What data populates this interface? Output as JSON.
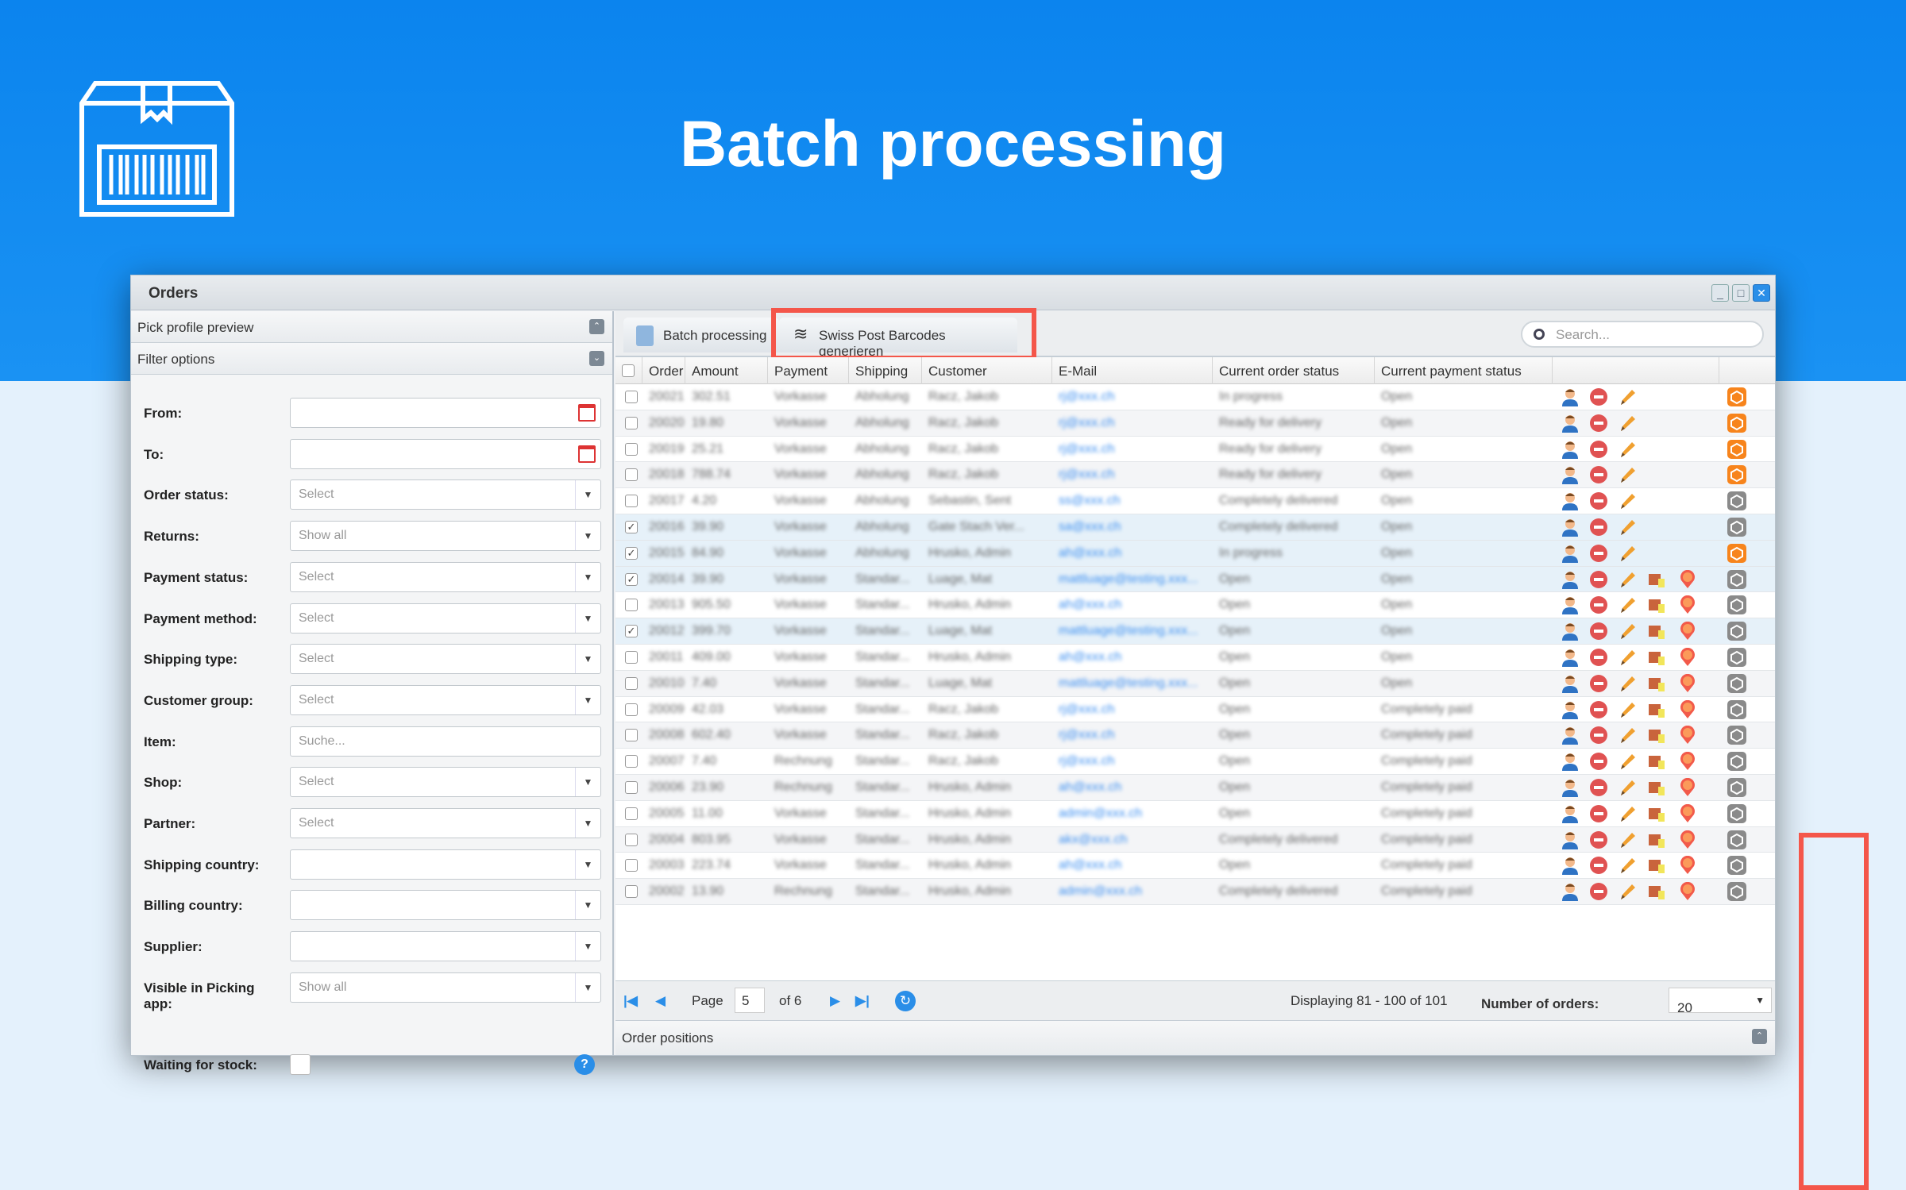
{
  "banner": {
    "title": "Batch processing",
    "logo": "barcode-box-icon",
    "bg": "#0b84ee"
  },
  "window": {
    "title": "Orders",
    "controls": [
      "minimize",
      "maximize",
      "close"
    ]
  },
  "left": {
    "pick_profile": "Pick profile preview",
    "filter_options": "Filter options",
    "filters": [
      {
        "label": "From:",
        "value": "",
        "type": "date"
      },
      {
        "label": "To:",
        "value": "",
        "type": "date"
      },
      {
        "label": "Order status:",
        "value": "Select",
        "type": "select"
      },
      {
        "label": "Returns:",
        "value": "Show all",
        "type": "select"
      },
      {
        "label": "Payment status:",
        "value": "Select",
        "type": "select"
      },
      {
        "label": "Payment method:",
        "value": "Select",
        "type": "select"
      },
      {
        "label": "Shipping type:",
        "value": "Select",
        "type": "select"
      },
      {
        "label": "Customer group:",
        "value": "Select",
        "type": "select"
      },
      {
        "label": "Item:",
        "value": "Suche...",
        "type": "text"
      },
      {
        "label": "Shop:",
        "value": "Select",
        "type": "select"
      },
      {
        "label": "Partner:",
        "value": "Select",
        "type": "select"
      },
      {
        "label": "Shipping country:",
        "value": "",
        "type": "select"
      },
      {
        "label": "Billing country:",
        "value": "",
        "type": "select"
      },
      {
        "label": "Supplier:",
        "value": "",
        "type": "select"
      },
      {
        "label": "Visible in Picking app:",
        "value": "Show all",
        "type": "select"
      }
    ],
    "waiting": "Waiting for stock:"
  },
  "toolbar": {
    "batch": "Batch processing",
    "swiss": "Swiss Post Barcodes generieren",
    "search_placeholder": "Search..."
  },
  "columns": [
    "Order numb",
    "Amount",
    "Payment",
    "Shipping",
    "Customer",
    "E-Mail",
    "Current order status",
    "Current payment status"
  ],
  "rows": [
    [
      "20021",
      "302.51",
      "Vorkasse",
      "Abholung",
      "Racz, Jakob",
      "rj@xxx.ch",
      "In progress",
      "Open",
      false,
      "orange",
      false
    ],
    [
      "20020",
      "19.80",
      "Vorkasse",
      "Abholung",
      "Racz, Jakob",
      "rj@xxx.ch",
      "Ready for delivery",
      "Open",
      false,
      "orange",
      false
    ],
    [
      "20019",
      "25.21",
      "Vorkasse",
      "Abholung",
      "Racz, Jakob",
      "rj@xxx.ch",
      "Ready for delivery",
      "Open",
      false,
      "orange",
      false
    ],
    [
      "20018",
      "788.74",
      "Vorkasse",
      "Abholung",
      "Racz, Jakob",
      "rj@xxx.ch",
      "Ready for delivery",
      "Open",
      false,
      "orange",
      false
    ],
    [
      "20017",
      "4.20",
      "Vorkasse",
      "Abholung",
      "Sebastin, Sent",
      "ss@xxx.ch",
      "Completely delivered",
      "Open",
      false,
      "gray",
      false
    ],
    [
      "20016",
      "39.90",
      "Vorkasse",
      "Abholung",
      "Gate Stach Ver...",
      "sa@xxx.ch",
      "Completely delivered",
      "Open",
      true,
      "gray",
      false
    ],
    [
      "20015",
      "84.90",
      "Vorkasse",
      "Abholung",
      "Hrusko, Admin",
      "ah@xxx.ch",
      "In progress",
      "Open",
      true,
      "orange",
      false
    ],
    [
      "20014",
      "39.90",
      "Vorkasse",
      "Standar...",
      "Luage, Mat",
      "mattluage@testing.xxx...",
      "Open",
      "Open",
      true,
      "gray",
      true
    ],
    [
      "20013",
      "905.50",
      "Vorkasse",
      "Standar...",
      "Hrusko, Admin",
      "ah@xxx.ch",
      "Open",
      "Open",
      false,
      "gray",
      true
    ],
    [
      "20012",
      "399.70",
      "Vorkasse",
      "Standar...",
      "Luage, Mat",
      "mattluage@testing.xxx...",
      "Open",
      "Open",
      true,
      "gray",
      true
    ],
    [
      "20011",
      "409.00",
      "Vorkasse",
      "Standar...",
      "Hrusko, Admin",
      "ah@xxx.ch",
      "Open",
      "Open",
      false,
      "gray",
      true
    ],
    [
      "20010",
      "7.40",
      "Vorkasse",
      "Standar...",
      "Luage, Mat",
      "mattluage@testing.xxx...",
      "Open",
      "Open",
      false,
      "gray",
      true
    ],
    [
      "20009",
      "42.03",
      "Vorkasse",
      "Standar...",
      "Racz, Jakob",
      "rj@xxx.ch",
      "Open",
      "Completely paid",
      false,
      "gray",
      true
    ],
    [
      "20008",
      "602.40",
      "Vorkasse",
      "Standar...",
      "Racz, Jakob",
      "rj@xxx.ch",
      "Open",
      "Completely paid",
      false,
      "gray",
      true
    ],
    [
      "20007",
      "7.40",
      "Rechnung",
      "Standar...",
      "Racz, Jakob",
      "rj@xxx.ch",
      "Open",
      "Completely paid",
      false,
      "gray",
      true
    ],
    [
      "20006",
      "23.90",
      "Rechnung",
      "Standar...",
      "Hrusko, Admin",
      "ah@xxx.ch",
      "Open",
      "Completely paid",
      false,
      "gray",
      true
    ],
    [
      "20005",
      "11.00",
      "Vorkasse",
      "Standar...",
      "Hrusko, Admin",
      "admin@xxx.ch",
      "Open",
      "Completely paid",
      false,
      "gray",
      true
    ],
    [
      "20004",
      "803.95",
      "Vorkasse",
      "Standar...",
      "Hrusko, Admin",
      "akx@xxx.ch",
      "Completely delivered",
      "Completely paid",
      false,
      "gray",
      true
    ],
    [
      "20003",
      "223.74",
      "Vorkasse",
      "Standar...",
      "Hrusko, Admin",
      "ah@xxx.ch",
      "Open",
      "Completely paid",
      false,
      "gray",
      true
    ],
    [
      "20002",
      "13.90",
      "Rechnung",
      "Standar...",
      "Hrusko, Admin",
      "admin@xxx.ch",
      "Completely delivered",
      "Completely paid",
      false,
      "gray",
      true
    ]
  ],
  "pager": {
    "page_label": "Page",
    "page": "5",
    "of": "of 6",
    "displaying": "Displaying 81 - 100 of 101",
    "number_label": "Number of orders:",
    "number": "20"
  },
  "order_positions": "Order positions",
  "colors": {
    "highlight": "#f4564a",
    "accent": "#2a8ee8",
    "orange": "#f7841c",
    "gray": "#8a8a8a"
  }
}
